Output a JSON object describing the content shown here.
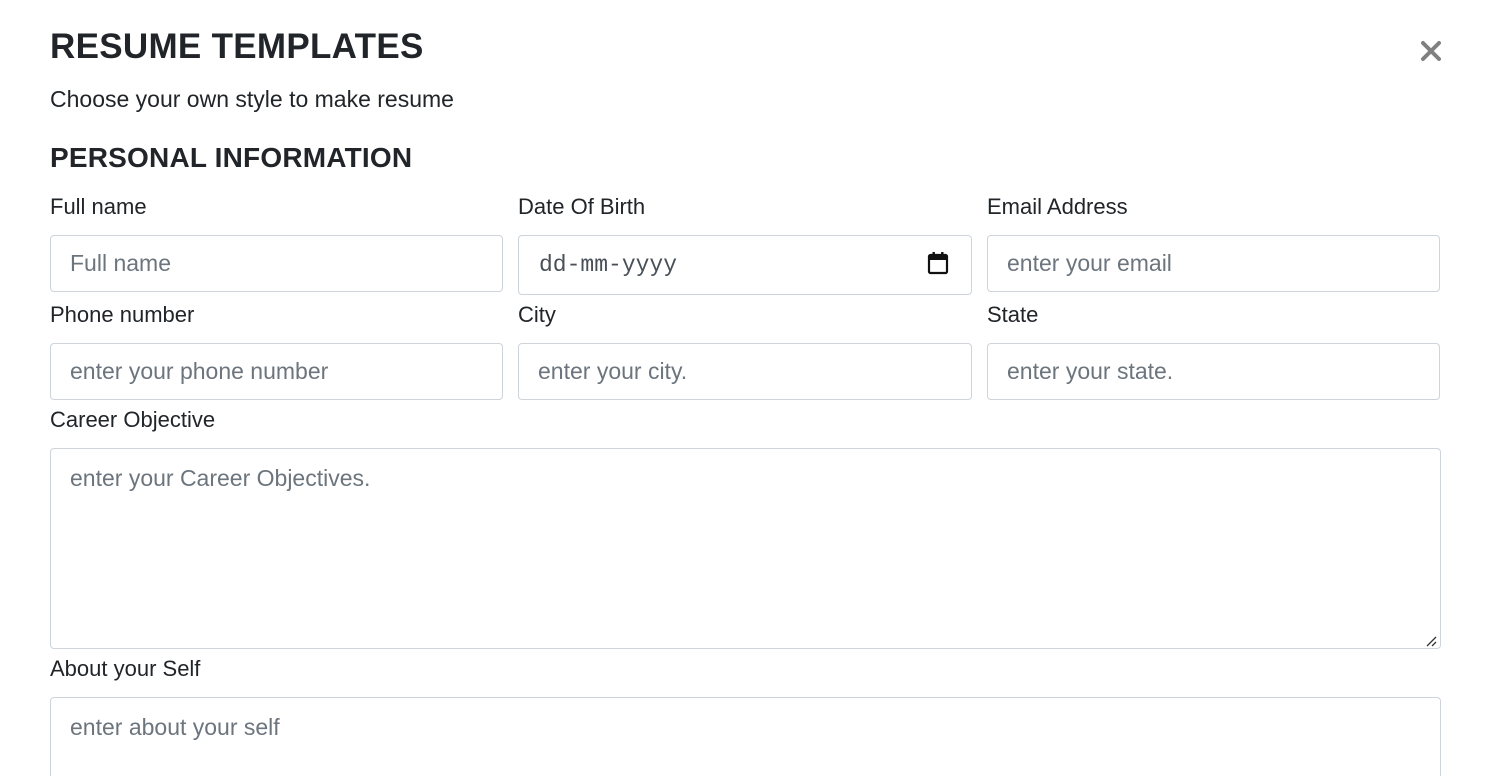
{
  "header": {
    "title": "RESUME TEMPLATES",
    "subtitle": "Choose your own style to make resume",
    "close_label": "×"
  },
  "section": {
    "title": "PERSONAL INFORMATION"
  },
  "fields": {
    "full_name": {
      "label": "Full name",
      "placeholder": "Full name",
      "value": ""
    },
    "dob": {
      "label": "Date Of Birth",
      "placeholder": "dd-mm-yyyy",
      "value": ""
    },
    "email": {
      "label": "Email Address",
      "placeholder": "enter your email",
      "value": ""
    },
    "phone": {
      "label": "Phone number",
      "placeholder": "enter your phone number",
      "value": ""
    },
    "city": {
      "label": "City",
      "placeholder": "enter your city.",
      "value": ""
    },
    "state": {
      "label": "State",
      "placeholder": "enter your state.",
      "value": ""
    },
    "career_objective": {
      "label": "Career Objective",
      "placeholder": "enter your Career Objectives.",
      "value": ""
    },
    "about": {
      "label": "About your Self",
      "placeholder": "enter about your self",
      "value": ""
    }
  },
  "icons": {
    "close": "close-icon",
    "calendar": "calendar-icon",
    "resize": "resize-handle-icon"
  },
  "colors": {
    "text": "#212529",
    "placeholder": "#6c757d",
    "border": "#ced4da",
    "close_icon": "#808080"
  }
}
